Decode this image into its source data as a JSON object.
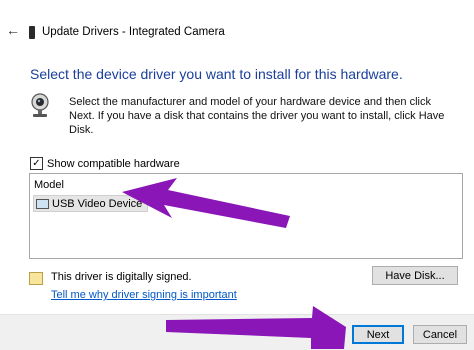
{
  "window": {
    "back_glyph": "←",
    "title": "Update Drivers - Integrated Camera"
  },
  "main": {
    "heading": "Select the device driver you want to install for this hardware.",
    "description": "Select the manufacturer and model of your hardware device and then click Next. If you have a disk that contains the driver you want to install, click Have Disk."
  },
  "compatible": {
    "label": "Show compatible hardware",
    "checked": true,
    "check_glyph": "✓"
  },
  "model_list": {
    "column_header": "Model",
    "items": [
      {
        "label": "USB Video Device",
        "selected": true
      }
    ]
  },
  "signature": {
    "status": "This driver is digitally signed.",
    "link": "Tell me why driver signing is important"
  },
  "buttons": {
    "have_disk": "Have Disk...",
    "next": "Next",
    "cancel": "Cancel"
  },
  "colors": {
    "heading": "#1a3f9c",
    "link": "#0058c8",
    "annotation_arrow": "#8a16b8",
    "default_button_border": "#0078d7"
  },
  "icons": {
    "back": "back-arrow-icon",
    "device": "device-icon",
    "camera": "webcam-icon",
    "usb": "usb-device-icon",
    "signature": "certificate-icon"
  }
}
